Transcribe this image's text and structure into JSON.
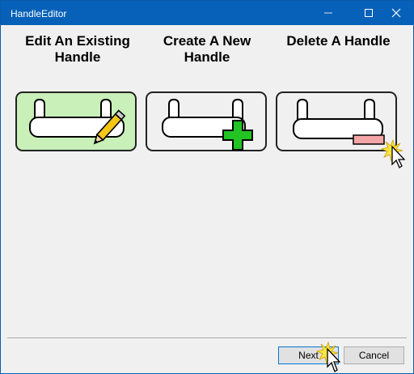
{
  "window": {
    "title": "HandleEditor",
    "title_bar_color": "#0761b8"
  },
  "options": [
    {
      "label": "Edit An Existing\nHandle",
      "icon": "handle-edit-icon",
      "selected": true
    },
    {
      "label": "Create A New\nHandle",
      "icon": "handle-add-icon",
      "selected": false
    },
    {
      "label": "Delete A Handle",
      "icon": "handle-delete-icon",
      "selected": false
    }
  ],
  "footer": {
    "next_label": "Next",
    "cancel_label": "Cancel"
  },
  "colors": {
    "selected_card": "#c8f0b8",
    "plus_green": "#22c322",
    "delete_pink": "#f4a6a6",
    "pencil_yellow": "#f5c518"
  }
}
